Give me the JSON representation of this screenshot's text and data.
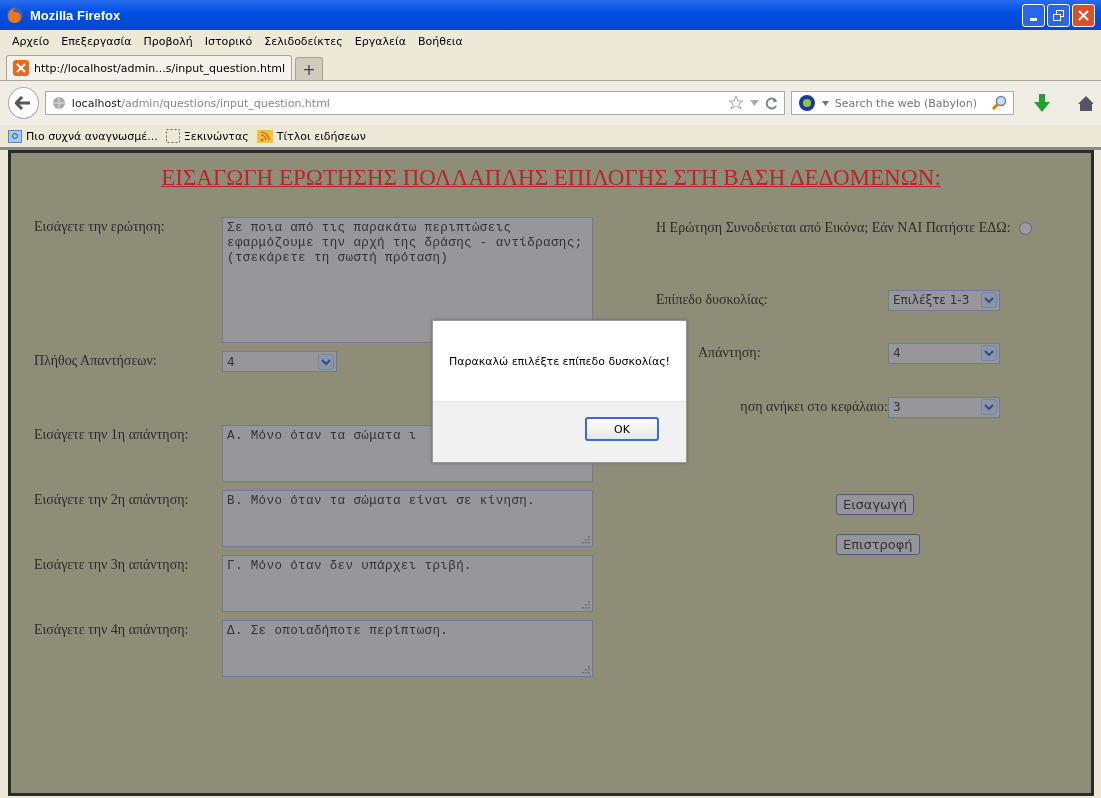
{
  "window": {
    "title": "Mozilla Firefox"
  },
  "menu": [
    "Αρχείο",
    "Επεξεργασία",
    "Προβολή",
    "Ιστορικό",
    "Σελιδοδείκτες",
    "Εργαλεία",
    "Βοήθεια"
  ],
  "tabs": [
    {
      "label": "http://localhost/admin...s/input_question.html",
      "selected": true
    }
  ],
  "new_tab": "+",
  "address": {
    "host": "localhost",
    "path": "/admin/questions/input_question.html"
  },
  "search": {
    "placeholder": "Search the web (Babylon)"
  },
  "bookmarks": [
    "Πιο συχνά αναγνωσμέ...",
    "Ξεκινώντας",
    "Τίτλοι ειδήσεων"
  ],
  "page": {
    "heading": "ΕΙΣΑΓΩΓΗ ΕΡΩΤΗΣΗΣ ΠΟΛΛΑΠΛΗΣ ΕΠΙΛΟΓΗΣ ΣΤΗ ΒΑΣΗ ΔΕΔΟΜΕΝΩΝ:",
    "question": {
      "label": "Εισάγετε την ερώτηση:",
      "value": "Σε ποια από τις παρακάτω περιπτώσεις εφαρμόζουμε την αρχή της δράσης - αντίδρασης; (τσεκάρετε τη σωστή πρόταση)"
    },
    "answer_count": {
      "label": "Πλήθος Απαντήσεων:",
      "value": "4"
    },
    "answers": [
      {
        "label": "Εισάγετε την 1η απάντηση:",
        "value": "Α. Μόνο όταν τα σώματα ι"
      },
      {
        "label": "Εισάγετε την 2η απάντηση:",
        "value": "Β. Μόνο όταν τα σώματα είναι σε κίνηση."
      },
      {
        "label": "Εισάγετε την 3η απάντηση:",
        "value": "Γ. Μόνο όταν δεν υπάρχει τριβή."
      },
      {
        "label": "Εισάγετε την 4η απάντηση:",
        "value": "Δ. Σε οποιαδήποτε περίπτωση."
      }
    ],
    "image_prompt": {
      "label": "Η Ερώτηση Συνοδεύεται από Εικόνα; Εάν ΝΑΙ Πατήστε ΕΔΩ:",
      "selected": false
    },
    "difficulty": {
      "label": "Επίπεδο δυσκολίας:",
      "value": "Επιλέξτε 1-3"
    },
    "correct": {
      "label": "Απάντηση:",
      "value": "4"
    },
    "chapter": {
      "label": "ηση ανήκει στο κεφάλαιο:",
      "value": "3"
    },
    "buttons": [
      "Εισαγωγή",
      "Επιστροφή"
    ]
  },
  "dialog": {
    "message": "Παρακαλώ επιλέξτε επίπεδο δυσκολίας!",
    "button": "OK"
  }
}
